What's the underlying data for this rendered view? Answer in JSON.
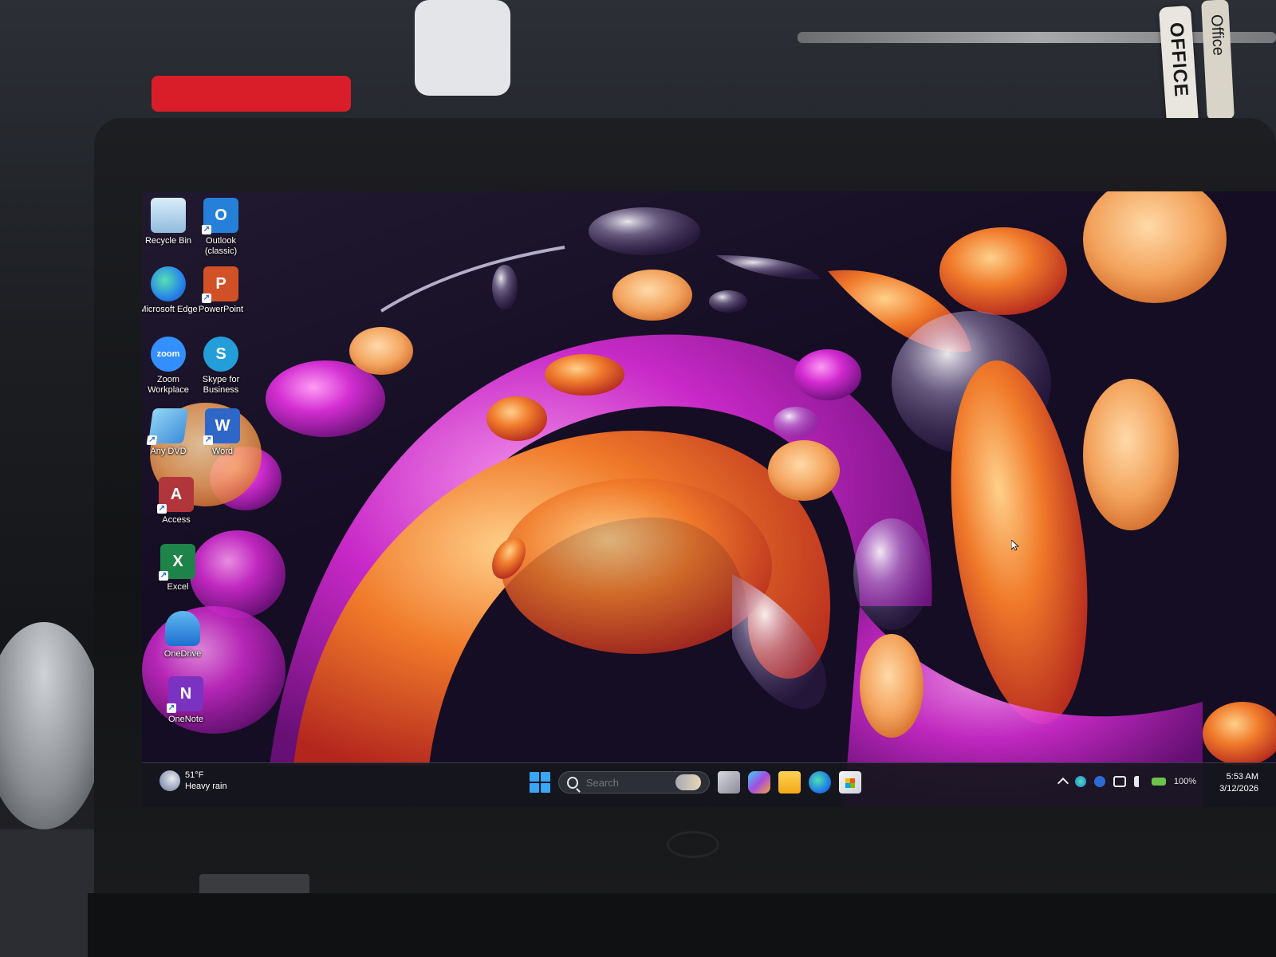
{
  "surroundings": {
    "office_tag_text": "OFFICE",
    "office_tag2_text": "Office"
  },
  "desktop": {
    "icons": [
      {
        "label": "Recycle Bin",
        "icon": "recycle-bin-icon",
        "color": "#9fc7e8"
      },
      {
        "label": "Outlook (classic)",
        "icon": "outlook-icon",
        "color": "#1b7ad8"
      },
      {
        "label": "Microsoft Edge",
        "icon": "edge-icon",
        "color": "#1f9be0"
      },
      {
        "label": "PowerPoint",
        "icon": "powerpoint-icon",
        "color": "#d04a1f"
      },
      {
        "label": "Zoom Workplace",
        "icon": "zoom-icon",
        "color": "#2d8cff"
      },
      {
        "label": "Skype for Business",
        "icon": "skype-icon",
        "color": "#1e9bd8"
      },
      {
        "label": "Any DVD",
        "icon": "any-dvd-icon",
        "color": "#5cb8e8"
      },
      {
        "label": "Word",
        "icon": "word-icon",
        "color": "#2b64c8"
      },
      {
        "label": "Access",
        "icon": "access-icon",
        "color": "#b03439"
      },
      {
        "label": "Excel",
        "icon": "excel-icon",
        "color": "#1d8348"
      },
      {
        "label": "OneDrive",
        "icon": "onedrive-icon",
        "color": "#2a8ae0"
      },
      {
        "label": "OneNote",
        "icon": "onenote-icon",
        "color": "#7b32c0"
      }
    ],
    "glyphs": {
      "outlook": "O",
      "powerpoint": "P",
      "zoom": "zoom",
      "skype": "S",
      "word": "W",
      "access": "A",
      "excel": "X",
      "onenote": "N"
    }
  },
  "taskbar": {
    "weather_temp": "51°F",
    "weather_desc": "Heavy rain",
    "search_placeholder": "Search",
    "battery": "100%",
    "time": "5:53 AM",
    "date": "3/12/2026",
    "accent": "#39a7f5"
  }
}
